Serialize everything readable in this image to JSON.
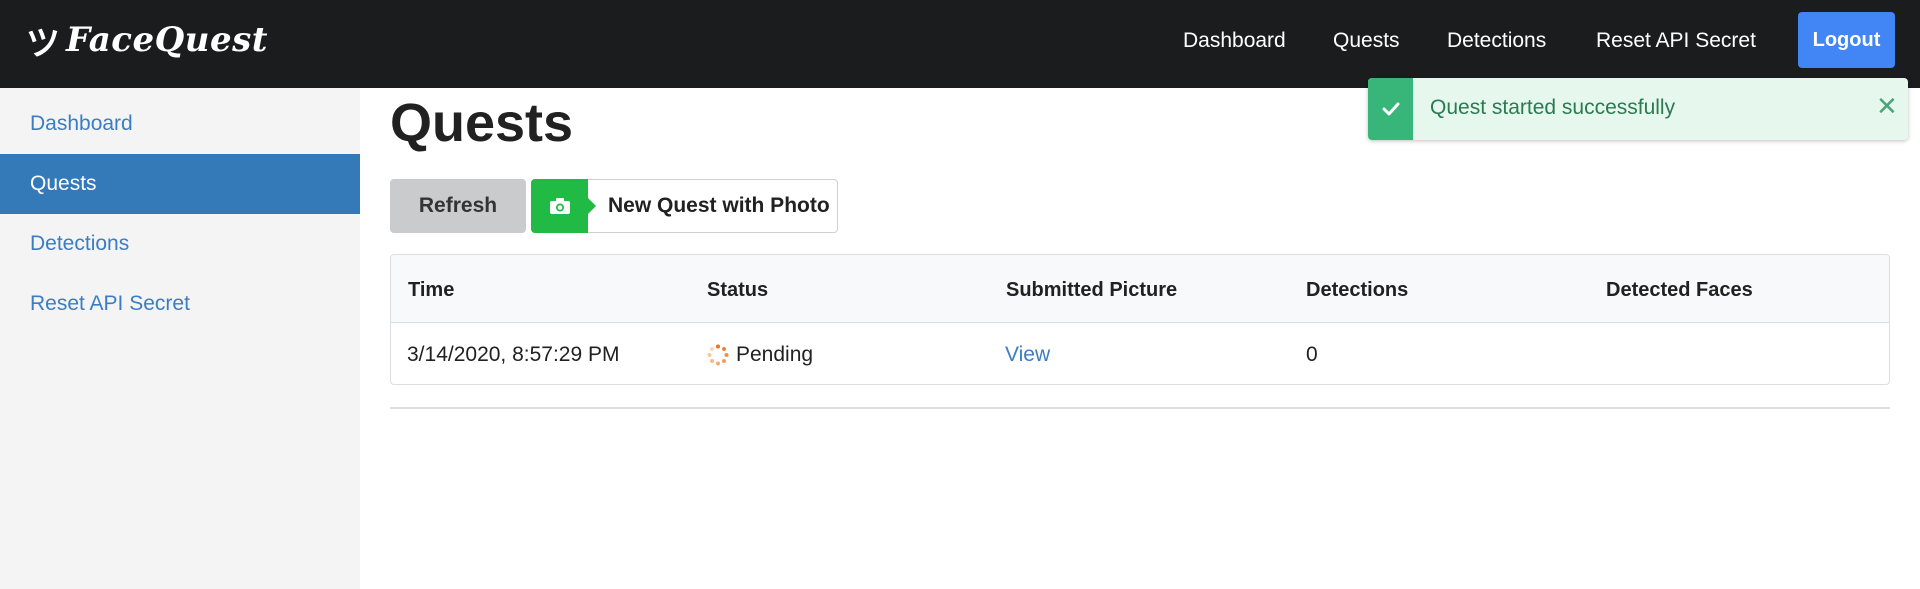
{
  "brand": {
    "logo_glyph": "ツ",
    "name": "FaceQuest"
  },
  "topnav": {
    "links": [
      "Dashboard",
      "Quests",
      "Detections",
      "Reset API Secret"
    ],
    "logout_label": "Logout"
  },
  "sidebar": {
    "items": [
      {
        "label": "Dashboard",
        "active": false
      },
      {
        "label": "Quests",
        "active": true
      },
      {
        "label": "Detections",
        "active": false
      },
      {
        "label": "Reset API Secret",
        "active": false
      }
    ]
  },
  "main": {
    "title": "Quests",
    "refresh_label": "Refresh",
    "new_quest_label": "New Quest with Photo",
    "new_quest_icon": "camera-icon"
  },
  "table": {
    "headers": [
      "Time",
      "Status",
      "Submitted Picture",
      "Detections",
      "Detected Faces"
    ],
    "rows": [
      {
        "time": "3/14/2020, 8:57:29 PM",
        "status": "Pending",
        "status_icon": "spinner-icon",
        "picture": "View",
        "detections": "0",
        "faces": ""
      }
    ]
  },
  "toast": {
    "message": "Quest started successfully",
    "icon": "check-icon",
    "close_icon": "close-icon"
  },
  "colors": {
    "navbar": "#1b1c1d",
    "logout": "#4285f4",
    "sidebar_active": "#357ab8",
    "link": "#3b7dc4",
    "new_quest_green": "#21ba45",
    "toast_bg": "#e6f8ee",
    "toast_accent": "#38b67a",
    "spinner": "#f2711c"
  }
}
